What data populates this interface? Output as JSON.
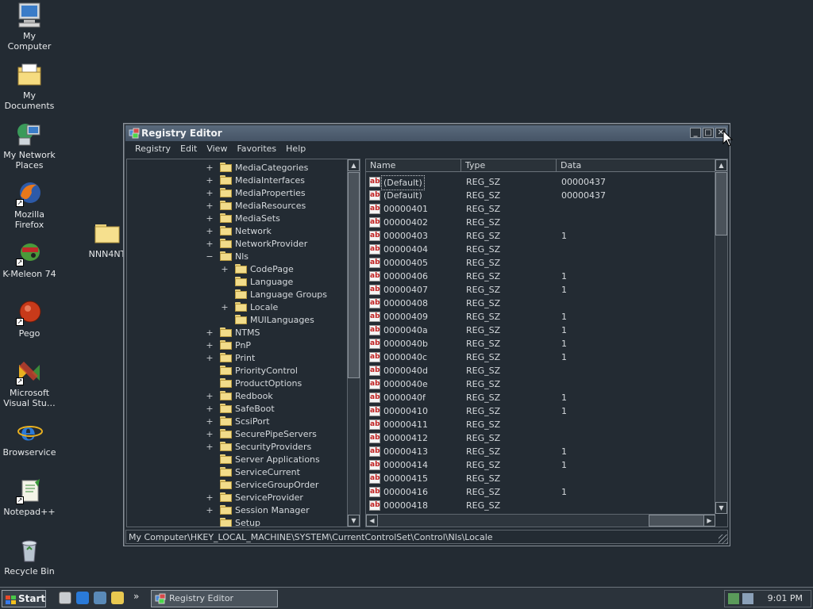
{
  "desktop": {
    "icons": [
      {
        "label": "My Computer",
        "icon": "computer-icon"
      },
      {
        "label": "My Documents",
        "icon": "documents-icon"
      },
      {
        "label": "My Network Places",
        "icon": "network-icon"
      },
      {
        "label": "Mozilla Firefox",
        "icon": "firefox-icon"
      },
      {
        "label": "K-Meleon 74",
        "icon": "kmeleon-icon"
      },
      {
        "label": "Pego",
        "icon": "pego-icon"
      },
      {
        "label": "Microsoft Visual Stu…",
        "icon": "visual-studio-icon"
      },
      {
        "label": "Browservice",
        "icon": "ie-icon"
      },
      {
        "label": "Notepad++",
        "icon": "notepadpp-icon"
      },
      {
        "label": "Recycle Bin",
        "icon": "recycle-bin-icon"
      }
    ],
    "folder_label": "NNN4NT"
  },
  "window": {
    "title": "Registry Editor",
    "menu": [
      "Registry",
      "Edit",
      "View",
      "Favorites",
      "Help"
    ],
    "status_path": "My Computer\\HKEY_LOCAL_MACHINE\\SYSTEM\\CurrentControlSet\\Control\\Nls\\Locale"
  },
  "tree": [
    {
      "label": "MediaCategories",
      "level": 0,
      "expander": "+"
    },
    {
      "label": "MediaInterfaces",
      "level": 0,
      "expander": "+"
    },
    {
      "label": "MediaProperties",
      "level": 0,
      "expander": "+"
    },
    {
      "label": "MediaResources",
      "level": 0,
      "expander": "+"
    },
    {
      "label": "MediaSets",
      "level": 0,
      "expander": "+"
    },
    {
      "label": "Network",
      "level": 0,
      "expander": "+"
    },
    {
      "label": "NetworkProvider",
      "level": 0,
      "expander": "+"
    },
    {
      "label": "Nls",
      "level": 0,
      "expander": "−"
    },
    {
      "label": "CodePage",
      "level": 1,
      "expander": "+"
    },
    {
      "label": "Language",
      "level": 1,
      "expander": ""
    },
    {
      "label": "Language Groups",
      "level": 1,
      "expander": ""
    },
    {
      "label": "Locale",
      "level": 1,
      "expander": "+"
    },
    {
      "label": "MUILanguages",
      "level": 1,
      "expander": ""
    },
    {
      "label": "NTMS",
      "level": 0,
      "expander": "+"
    },
    {
      "label": "PnP",
      "level": 0,
      "expander": "+"
    },
    {
      "label": "Print",
      "level": 0,
      "expander": "+"
    },
    {
      "label": "PriorityControl",
      "level": 0,
      "expander": ""
    },
    {
      "label": "ProductOptions",
      "level": 0,
      "expander": ""
    },
    {
      "label": "Redbook",
      "level": 0,
      "expander": "+"
    },
    {
      "label": "SafeBoot",
      "level": 0,
      "expander": "+"
    },
    {
      "label": "ScsiPort",
      "level": 0,
      "expander": "+"
    },
    {
      "label": "SecurePipeServers",
      "level": 0,
      "expander": "+"
    },
    {
      "label": "SecurityProviders",
      "level": 0,
      "expander": "+"
    },
    {
      "label": "Server Applications",
      "level": 0,
      "expander": ""
    },
    {
      "label": "ServiceCurrent",
      "level": 0,
      "expander": ""
    },
    {
      "label": "ServiceGroupOrder",
      "level": 0,
      "expander": ""
    },
    {
      "label": "ServiceProvider",
      "level": 0,
      "expander": "+"
    },
    {
      "label": "Session Manager",
      "level": 0,
      "expander": "+"
    },
    {
      "label": "Setup",
      "level": 0,
      "expander": ""
    }
  ],
  "list": {
    "columns": [
      "Name",
      "Type",
      "Data"
    ],
    "rows": [
      {
        "name": "(Default)",
        "type": "REG_SZ",
        "data": "00000437"
      },
      {
        "name": "(Default)",
        "type": "REG_SZ",
        "data": "00000437"
      },
      {
        "name": "00000401",
        "type": "REG_SZ",
        "data": ""
      },
      {
        "name": "00000402",
        "type": "REG_SZ",
        "data": ""
      },
      {
        "name": "00000403",
        "type": "REG_SZ",
        "data": "1"
      },
      {
        "name": "00000404",
        "type": "REG_SZ",
        "data": ""
      },
      {
        "name": "00000405",
        "type": "REG_SZ",
        "data": ""
      },
      {
        "name": "00000406",
        "type": "REG_SZ",
        "data": "1"
      },
      {
        "name": "00000407",
        "type": "REG_SZ",
        "data": "1"
      },
      {
        "name": "00000408",
        "type": "REG_SZ",
        "data": ""
      },
      {
        "name": "00000409",
        "type": "REG_SZ",
        "data": "1"
      },
      {
        "name": "0000040a",
        "type": "REG_SZ",
        "data": "1"
      },
      {
        "name": "0000040b",
        "type": "REG_SZ",
        "data": "1"
      },
      {
        "name": "0000040c",
        "type": "REG_SZ",
        "data": "1"
      },
      {
        "name": "0000040d",
        "type": "REG_SZ",
        "data": ""
      },
      {
        "name": "0000040e",
        "type": "REG_SZ",
        "data": ""
      },
      {
        "name": "0000040f",
        "type": "REG_SZ",
        "data": "1"
      },
      {
        "name": "00000410",
        "type": "REG_SZ",
        "data": "1"
      },
      {
        "name": "00000411",
        "type": "REG_SZ",
        "data": ""
      },
      {
        "name": "00000412",
        "type": "REG_SZ",
        "data": ""
      },
      {
        "name": "00000413",
        "type": "REG_SZ",
        "data": "1"
      },
      {
        "name": "00000414",
        "type": "REG_SZ",
        "data": "1"
      },
      {
        "name": "00000415",
        "type": "REG_SZ",
        "data": ""
      },
      {
        "name": "00000416",
        "type": "REG_SZ",
        "data": "1"
      },
      {
        "name": "00000418",
        "type": "REG_SZ",
        "data": ""
      }
    ]
  },
  "taskbar": {
    "start_label": "Start",
    "task_label": "Registry Editor",
    "clock": "9:01 PM",
    "overflow": "»"
  },
  "buttons": {
    "minimize": "_",
    "maximize": "□",
    "close": "✕"
  },
  "ab_icon": "ab"
}
